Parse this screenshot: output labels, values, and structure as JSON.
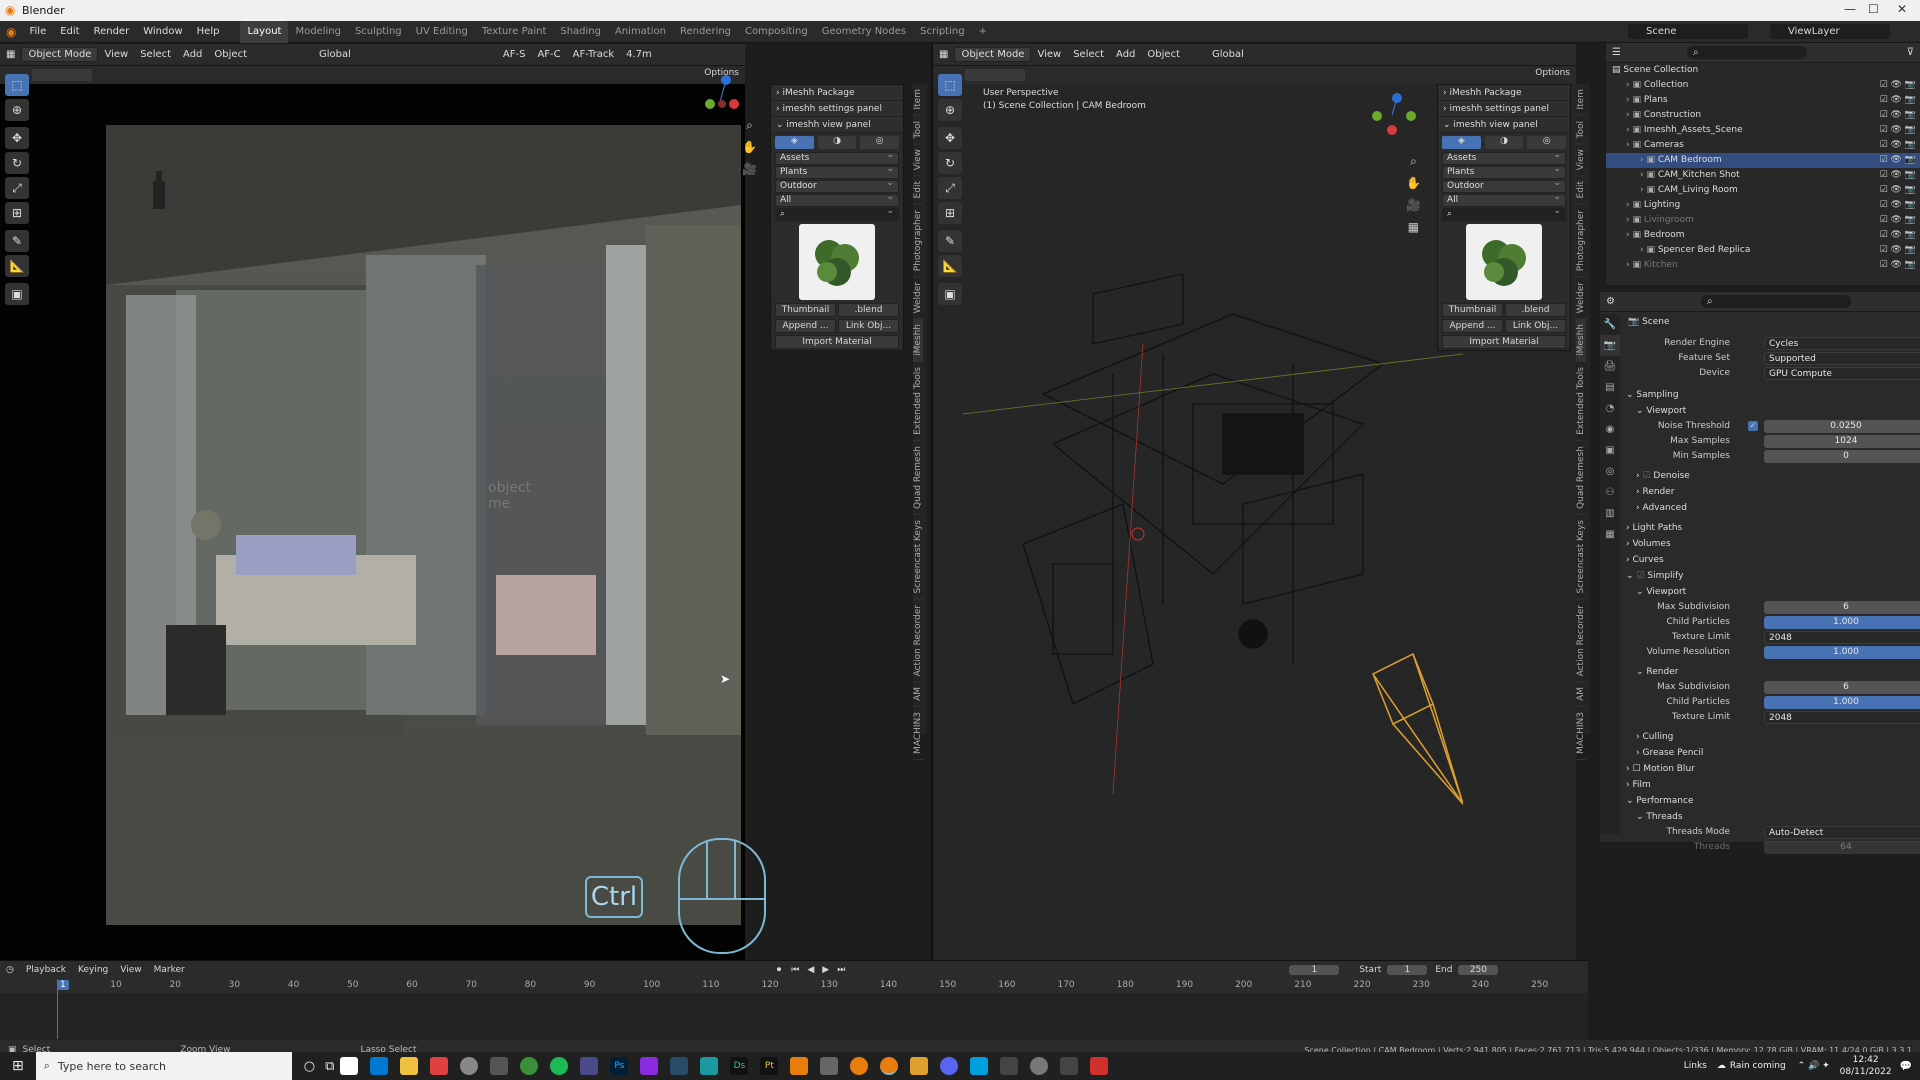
{
  "window": {
    "title": "Blender"
  },
  "menu": {
    "items": [
      "File",
      "Edit",
      "Render",
      "Window",
      "Help"
    ],
    "workspaces": [
      "Layout",
      "Modeling",
      "Sculpting",
      "UV Editing",
      "Texture Paint",
      "Shading",
      "Animation",
      "Rendering",
      "Compositing",
      "Geometry Nodes",
      "Scripting"
    ],
    "active_workspace": "Layout",
    "scene": "Scene",
    "view_layer": "ViewLayer"
  },
  "viewport_left": {
    "mode": "Object Mode",
    "menus": [
      "View",
      "Select",
      "Add",
      "Object"
    ],
    "transform": "Global",
    "af_s": "AF-S",
    "af_c": "AF-C",
    "af_track": "AF-Track",
    "focal": "4.7m",
    "options": "Options",
    "overlay_text": "object\nme",
    "key_hint": "Ctrl"
  },
  "viewport_right": {
    "mode": "Object Mode",
    "menus": [
      "View",
      "Select",
      "Add",
      "Object"
    ],
    "transform": "Global",
    "options": "Options",
    "perspective": "User Perspective",
    "collection": "(1) Scene Collection | CAM Bedroom"
  },
  "imesh_panel": {
    "headers": [
      "iMeshh Package",
      "imeshh settings panel",
      "imeshh view panel"
    ],
    "selects": [
      "Assets",
      "Plants",
      "Outdoor",
      "All"
    ],
    "thumbnail": "Thumbnail",
    "blend": ".blend",
    "append": "Append ...",
    "link": "Link Obj...",
    "import_material": "Import Material"
  },
  "side_tabs_left": [
    "Item",
    "Tool",
    "View",
    "Edit",
    "Photographer",
    "Welder",
    "iMeshh",
    "Extended Tools",
    "Quad Remesh",
    "Screencast Keys",
    "Action Recorder",
    "AM",
    "MACHIN3"
  ],
  "side_tabs_right": [
    "Item",
    "Tool",
    "View",
    "Edit",
    "Photographer",
    "Welder",
    "iMeshh",
    "Extended Tools",
    "Quad Remesh",
    "Screencast Keys",
    "Action Recorder",
    "AM",
    "MACHIN3"
  ],
  "outliner": {
    "root": "Scene Collection",
    "items": [
      {
        "label": "Collection",
        "indent": 1
      },
      {
        "label": "Plans",
        "indent": 1
      },
      {
        "label": "Construction",
        "indent": 1
      },
      {
        "label": "Imeshh_Assets_Scene",
        "indent": 1
      },
      {
        "label": "Cameras",
        "indent": 1
      },
      {
        "label": "CAM Bedroom",
        "indent": 2,
        "selected": true
      },
      {
        "label": "CAM_Kitchen Shot",
        "indent": 2
      },
      {
        "label": "CAM_Living Room",
        "indent": 2
      },
      {
        "label": "Lighting",
        "indent": 1
      },
      {
        "label": "Livingroom",
        "indent": 1,
        "dim": true
      },
      {
        "label": "Bedroom",
        "indent": 1
      },
      {
        "label": "Spencer Bed Replica",
        "indent": 2
      },
      {
        "label": "Kitchen",
        "indent": 1,
        "dim": true
      }
    ]
  },
  "properties": {
    "context": "Scene",
    "render_engine_label": "Render Engine",
    "render_engine": "Cycles",
    "feature_set_label": "Feature Set",
    "feature_set": "Supported",
    "device_label": "Device",
    "device": "GPU Compute",
    "sections": {
      "sampling": "Sampling",
      "viewport": "Viewport",
      "noise_threshold_label": "Noise Threshold",
      "noise_threshold": "0.0250",
      "max_samples_label": "Max Samples",
      "max_samples": "1024",
      "min_samples_label": "Min Samples",
      "min_samples": "0",
      "denoise": "Denoise",
      "render": "Render",
      "advanced": "Advanced",
      "light_paths": "Light Paths",
      "volumes": "Volumes",
      "curves": "Curves",
      "simplify": "Simplify",
      "simplify_viewport": "Viewport",
      "max_subdivision_label": "Max Subdivision",
      "max_subdivision": "6",
      "child_particles_label": "Child Particles",
      "child_particles": "1.000",
      "texture_limit_label": "Texture Limit",
      "texture_limit": "2048",
      "volume_resolution_label": "Volume Resolution",
      "volume_resolution": "1.000",
      "simplify_render": "Render",
      "render_max_subdivision": "6",
      "render_child_particles": "1.000",
      "render_texture_limit": "2048",
      "culling": "Culling",
      "grease_pencil": "Grease Pencil",
      "motion_blur": "Motion Blur",
      "film": "Film",
      "performance": "Performance",
      "threads": "Threads",
      "threads_mode_label": "Threads Mode",
      "threads_mode": "Auto-Detect",
      "threads_count_label": "Threads",
      "threads_count": "64"
    }
  },
  "timeline": {
    "menus": [
      "Playback",
      "Keying",
      "View",
      "Marker"
    ],
    "current_frame": "1",
    "start_label": "Start",
    "start": "1",
    "end_label": "End",
    "end": "250",
    "ticks": [
      "1",
      "10",
      "20",
      "30",
      "40",
      "50",
      "60",
      "70",
      "80",
      "90",
      "100",
      "110",
      "120",
      "130",
      "140",
      "150",
      "160",
      "170",
      "180",
      "190",
      "200",
      "210",
      "220",
      "230",
      "240",
      "250"
    ]
  },
  "statusbar": {
    "select": "Select",
    "zoom": "Zoom View",
    "lasso": "Lasso Select",
    "stats": "Scene Collection | CAM Bedroom | Verts:2,941,805 | Faces:2,761,713 | Tris:5,429,944 | Objects:1/336 | Memory: 12.78 GiB | VRAM: 11.4/24.0 GiB | 3.3.1"
  },
  "taskbar": {
    "search_placeholder": "Type here to search",
    "links": "Links",
    "weather": "Rain coming",
    "time": "12:42",
    "date": "08/11/2022"
  }
}
